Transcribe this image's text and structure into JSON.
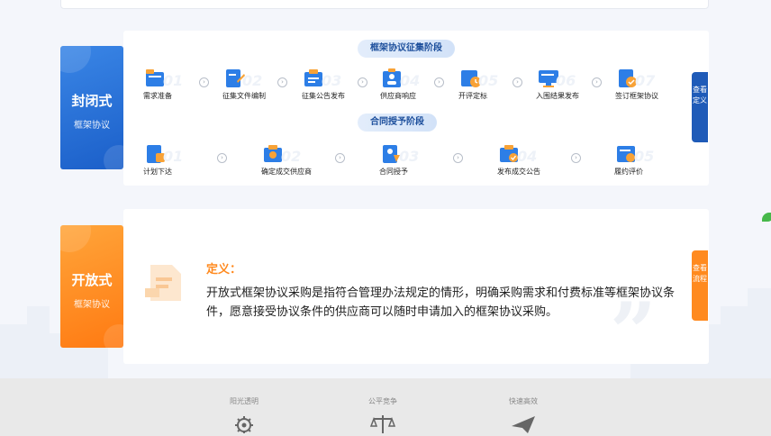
{
  "closed": {
    "tag_title": "封闭式",
    "tag_sub": "框架协议",
    "stage1_title": "框架协议征集阶段",
    "stage2_title": "合同授予阶段",
    "stage1_steps": [
      {
        "num": "01",
        "label": "需求准备",
        "icon": "folder-icon"
      },
      {
        "num": "02",
        "label": "征集文件编制",
        "icon": "document-edit-icon"
      },
      {
        "num": "03",
        "label": "征集公告发布",
        "icon": "announcement-icon"
      },
      {
        "num": "04",
        "label": "供应商响应",
        "icon": "supplier-icon"
      },
      {
        "num": "05",
        "label": "开评定标",
        "icon": "evaluation-icon"
      },
      {
        "num": "06",
        "label": "入围结果发布",
        "icon": "monitor-icon"
      },
      {
        "num": "07",
        "label": "签订框架协议",
        "icon": "sign-icon"
      }
    ],
    "stage2_steps": [
      {
        "num": "01",
        "label": "计划下达",
        "icon": "plan-icon"
      },
      {
        "num": "02",
        "label": "确定成交供应商",
        "icon": "confirm-icon"
      },
      {
        "num": "03",
        "label": "合同授予",
        "icon": "contract-icon"
      },
      {
        "num": "04",
        "label": "发布成交公告",
        "icon": "publish-icon"
      },
      {
        "num": "05",
        "label": "履约评价",
        "icon": "rating-icon"
      }
    ],
    "side_button": "查看定义"
  },
  "open": {
    "tag_title": "开放式",
    "tag_sub": "框架协议",
    "def_title": "定义：",
    "def_text": "开放式框架协议采购是指符合管理办法规定的情形，明确采购需求和付费标准等框架协议条件，愿意接受协议条件的供应商可以随时申请加入的框架协议采购。",
    "side_button": "查看流程"
  },
  "footer": {
    "features": [
      {
        "label": "阳光透明",
        "icon": "gear-icon"
      },
      {
        "label": "公平竞争",
        "icon": "scale-icon"
      },
      {
        "label": "快速高效",
        "icon": "paper-plane-icon"
      }
    ]
  },
  "colors": {
    "blue": "#1f5bb8",
    "orange": "#ff8a1f"
  }
}
